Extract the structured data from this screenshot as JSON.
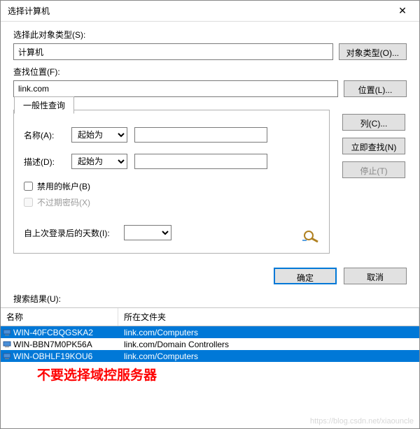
{
  "window": {
    "title": "选择计算机",
    "close": "✕"
  },
  "object_type": {
    "label": "选择此对象类型(S):",
    "value": "计算机",
    "button": "对象类型(O)..."
  },
  "location": {
    "label": "查找位置(F):",
    "value": "link.com",
    "button": "位置(L)..."
  },
  "tab": {
    "label": "一般性查询"
  },
  "query": {
    "name_label": "名称(A):",
    "desc_label": "描述(D):",
    "match_option": "起始为",
    "disabled_accounts": "禁用的帐户(B)",
    "no_expire_pw": "不过期密码(X)",
    "days_label": "自上次登录后的天数(I):"
  },
  "side": {
    "columns": "列(C)...",
    "find_now": "立即查找(N)",
    "stop": "停止(T)"
  },
  "actions": {
    "ok": "确定",
    "cancel": "取消"
  },
  "results": {
    "label": "搜索结果(U):",
    "col_name": "名称",
    "col_folder": "所在文件夹",
    "rows": [
      {
        "name": "WIN-40FCBQGSKA2",
        "folder": "link.com/Computers",
        "selected": true
      },
      {
        "name": "WIN-BBN7M0PK56A",
        "folder": "link.com/Domain Controllers",
        "selected": false
      },
      {
        "name": "WIN-OBHLF19KOU6",
        "folder": "link.com/Computers",
        "selected": true
      }
    ]
  },
  "warning": "不要选择域控服务器",
  "watermark": "https://blog.csdn.net/xiaouncle"
}
